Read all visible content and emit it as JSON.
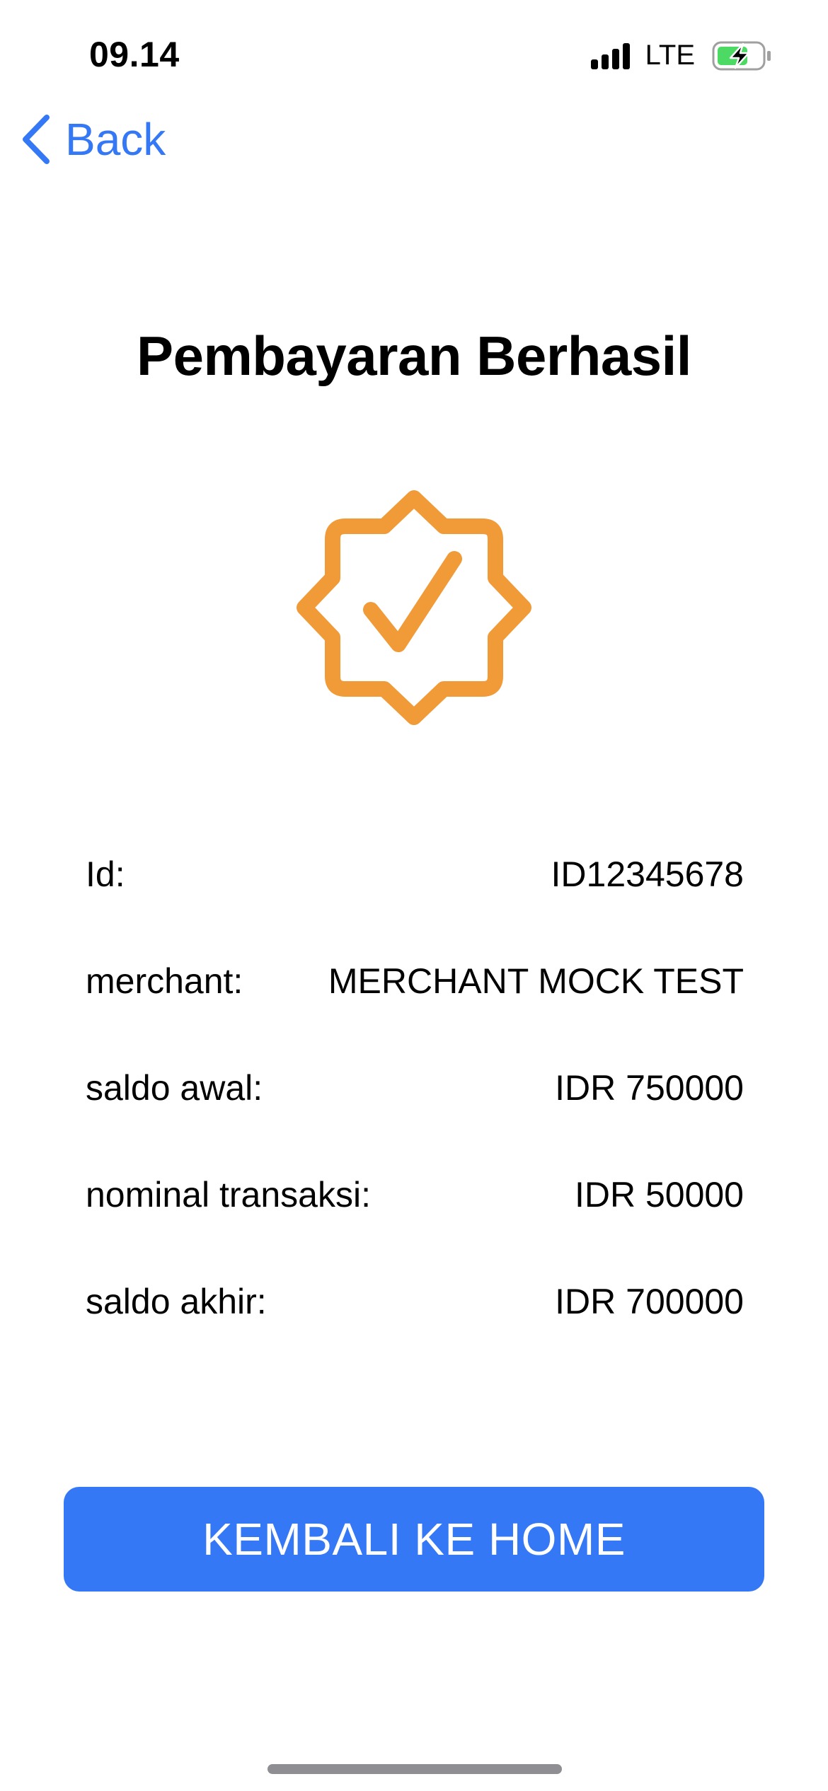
{
  "status_bar": {
    "time": "09.14",
    "network": "LTE",
    "icons": [
      "signal-icon",
      "battery-charging-icon"
    ]
  },
  "nav": {
    "back_label": "Back",
    "back_icon": "chevron-left-icon"
  },
  "title": "Pembayaran Berhasil",
  "badge": {
    "icon": "checkmark-seal-icon",
    "color": "#F09A38"
  },
  "details": [
    {
      "label": "Id:",
      "value": "ID12345678"
    },
    {
      "label": "merchant:",
      "value": "MERCHANT MOCK TEST"
    },
    {
      "label": "saldo awal:",
      "value": "IDR 750000"
    },
    {
      "label": "nominal transaksi:",
      "value": "IDR 50000"
    },
    {
      "label": "saldo akhir:",
      "value": "IDR 700000"
    }
  ],
  "primary_button": {
    "label": "KEMBALI KE HOME"
  },
  "colors": {
    "accent": "#3478F6",
    "badge": "#F09A38",
    "battery_fill": "#4CD964"
  }
}
